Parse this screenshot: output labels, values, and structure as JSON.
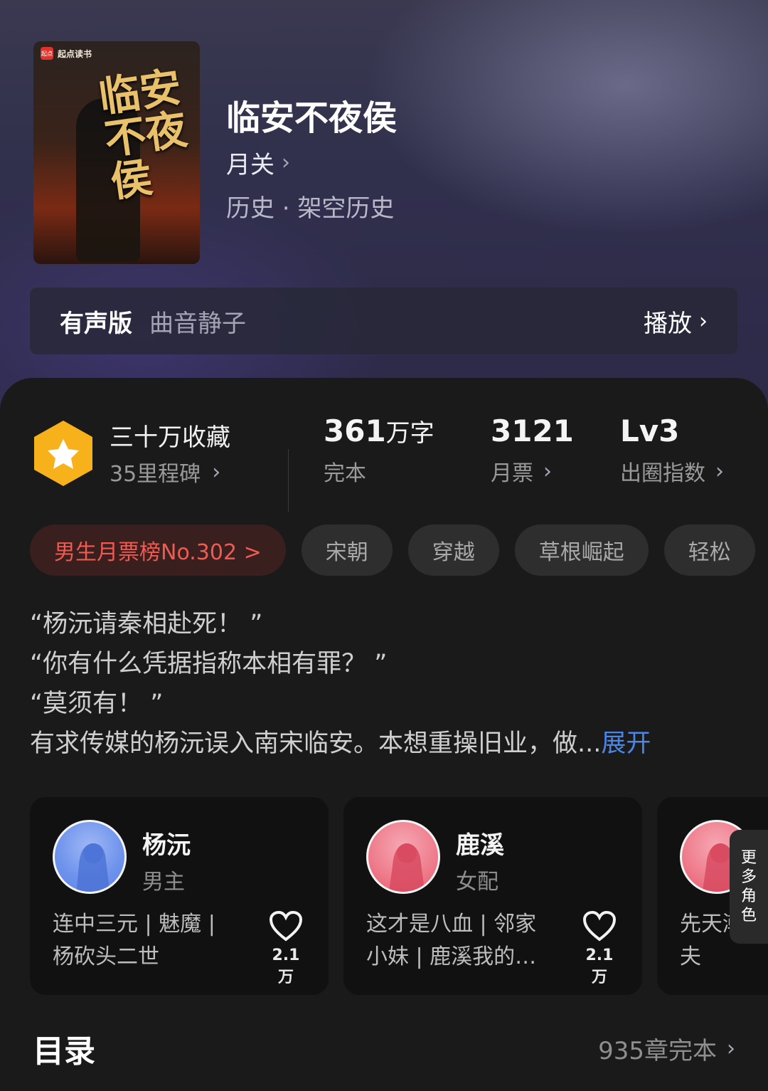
{
  "book": {
    "title": "临安不夜侯",
    "author": "月关",
    "genre": "历史 · 架空历史",
    "cover": {
      "brand": "起点读书",
      "title_art": "临安不夜侯"
    }
  },
  "audio": {
    "label": "有声版",
    "narrator": "曲音静子",
    "play_label": "播放"
  },
  "stats": {
    "favorites": "三十万收藏",
    "milestones": "35里程碑",
    "word_count": "361",
    "word_unit": "万字",
    "word_label": "完本",
    "monthly_votes": "3121",
    "monthly_label": "月票",
    "level": "Lv3",
    "level_label": "出圈指数"
  },
  "tags": [
    "男生月票榜No.302 >",
    "宋朝",
    "穿越",
    "草根崛起",
    "轻松"
  ],
  "synopsis": {
    "lines": [
      "“杨沅请秦相赴死！ ”",
      "“你有什么凭据指称本相有罪？ ”",
      "“莫须有！ ”"
    ],
    "last_line": "有求传媒的杨沅误入南宋临安。本想重操旧业，做...",
    "expand_label": "展开"
  },
  "characters": [
    {
      "name": "杨沅",
      "role": "男主",
      "desc": "连中三元 | 魅魔 | 杨砍头二世",
      "likes": "2.1万",
      "color": "#5c87e8"
    },
    {
      "name": "鹿溪",
      "role": "女配",
      "desc": "这才是八血 | 邻家小妹 | 鹿溪我的…",
      "likes": "2.1万",
      "color": "#e85a6e"
    },
    {
      "name": "",
      "role": "",
      "desc": "先天潮韵 | 血 | 李夫",
      "likes": "",
      "color": "#e85a6e"
    }
  ],
  "more_roles_label": "更多角色",
  "toc": {
    "title": "目录",
    "meta": "935章完本"
  },
  "colors": {
    "accent_blue": "#4a86e8",
    "rank_red": "#f05a50",
    "badge_yellow": "#f7b21b"
  }
}
